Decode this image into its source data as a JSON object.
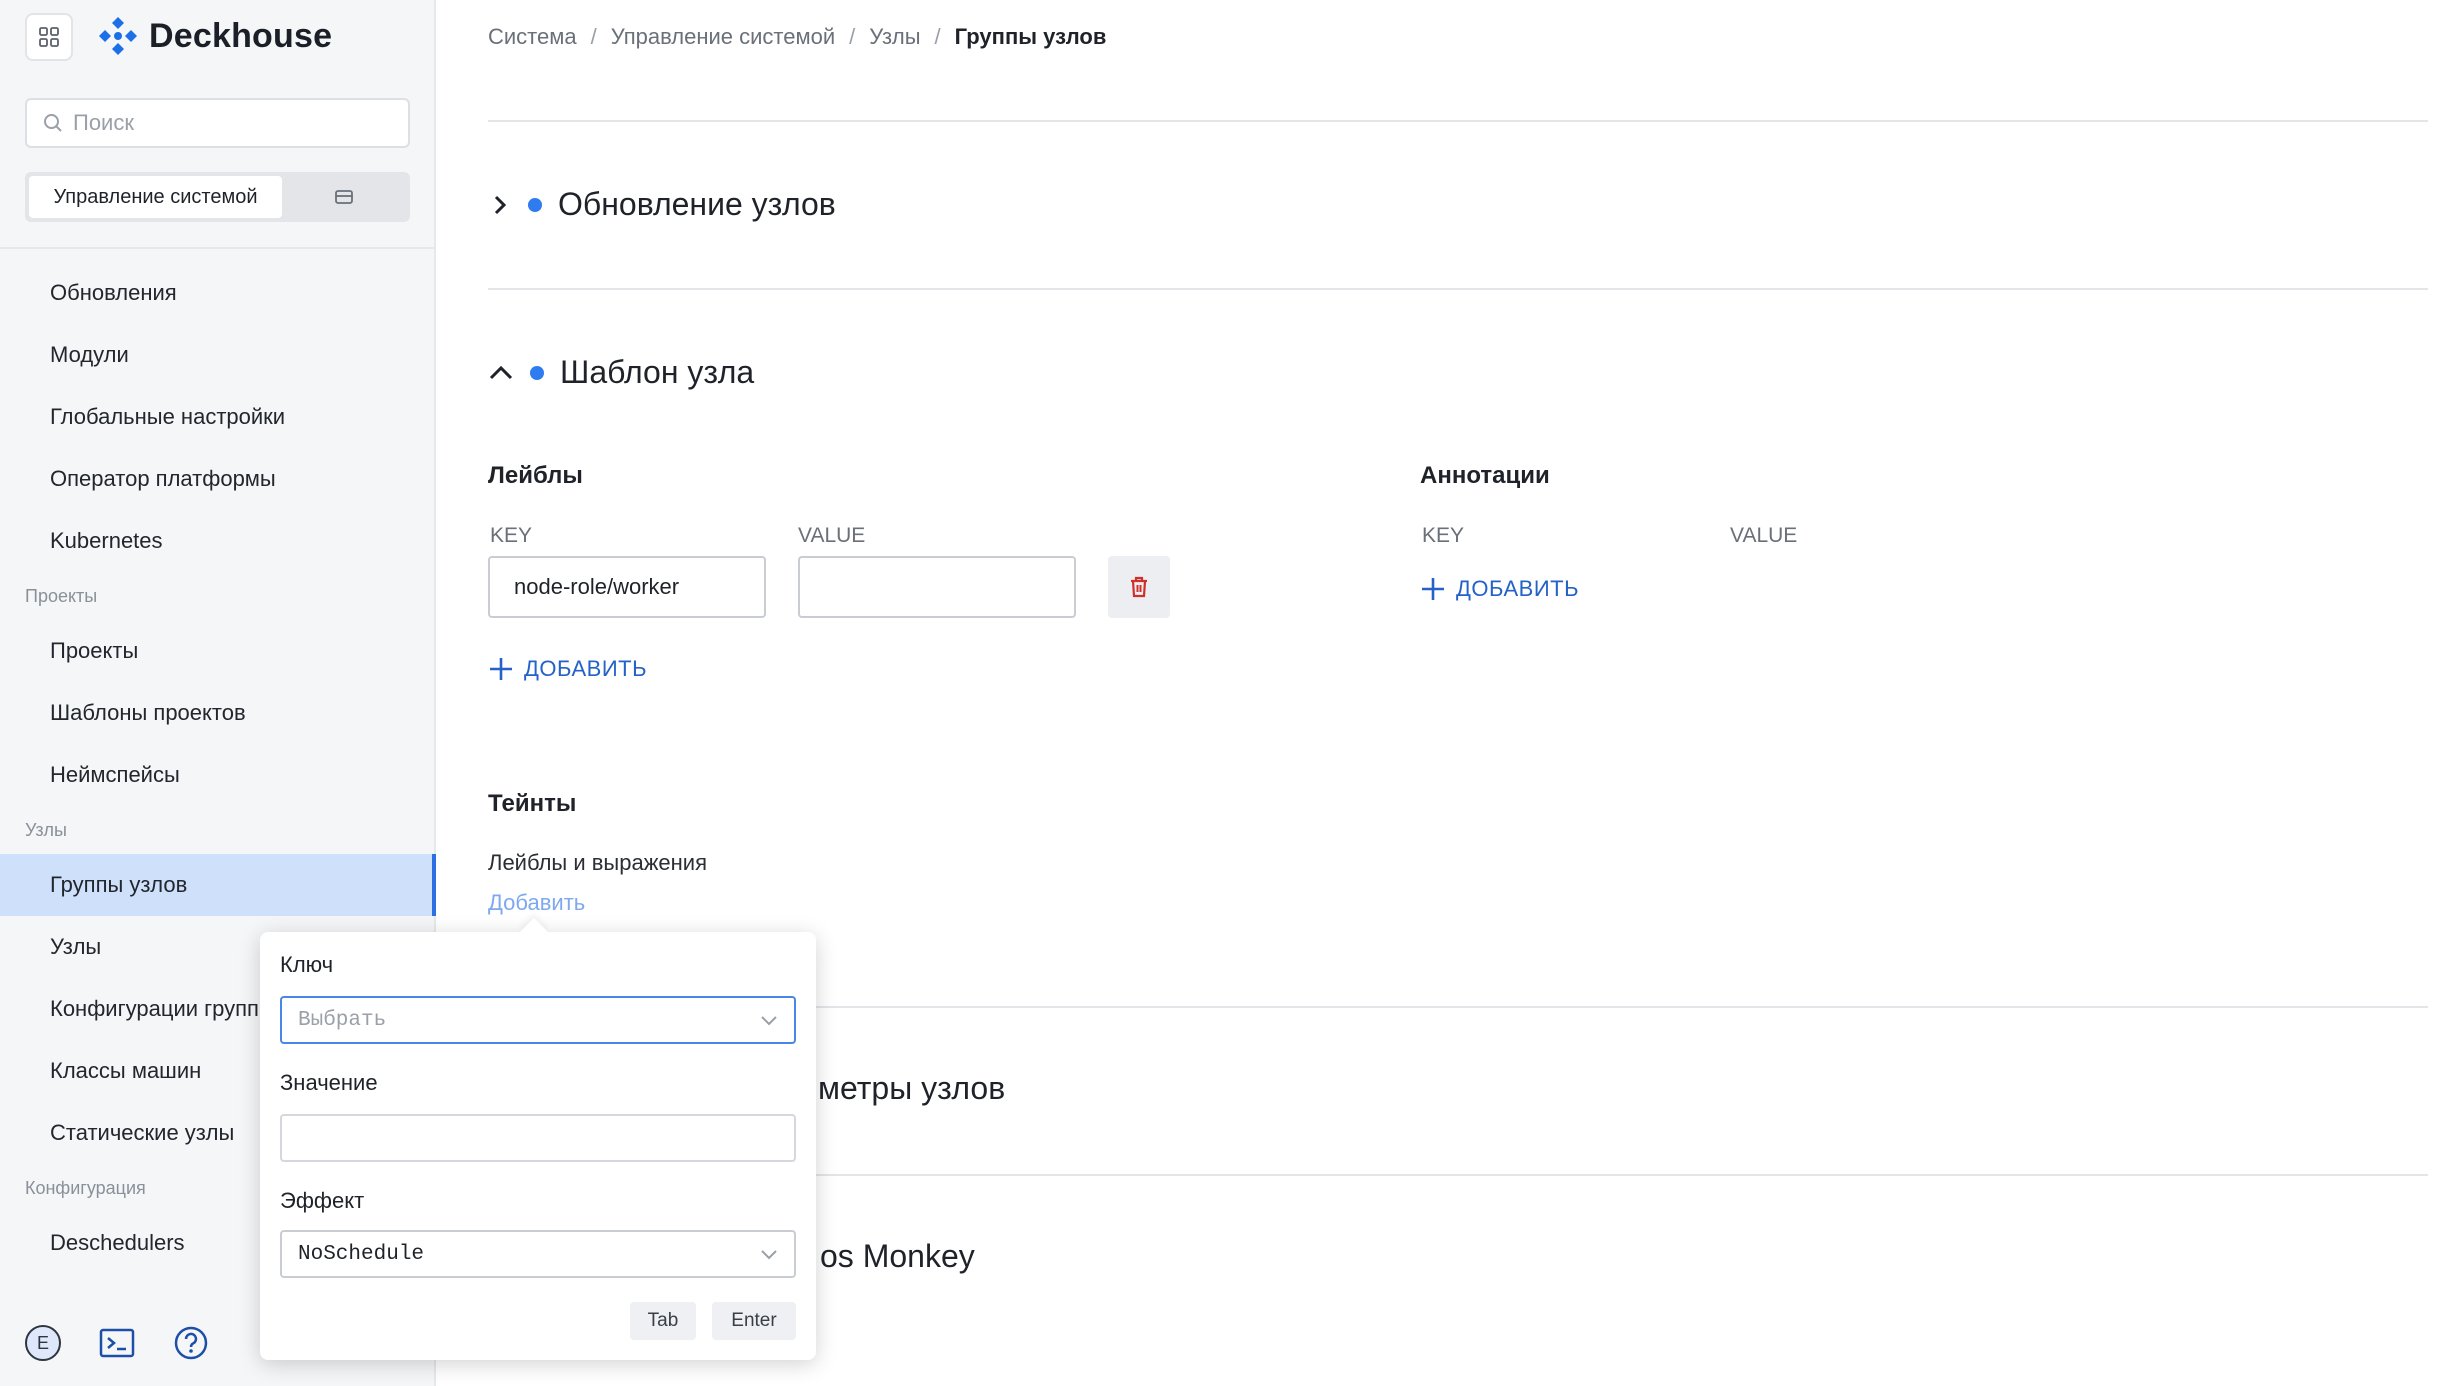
{
  "app": {
    "name": "Deckhouse"
  },
  "sidebar": {
    "search_placeholder": "Поиск",
    "segment_active": "Управление системой",
    "items": [
      {
        "type": "item",
        "label": "Обновления"
      },
      {
        "type": "item",
        "label": "Модули"
      },
      {
        "type": "item",
        "label": "Глобальные настройки"
      },
      {
        "type": "item",
        "label": "Оператор платформы"
      },
      {
        "type": "item",
        "label": "Kubernetes"
      },
      {
        "type": "group",
        "label": "Проекты"
      },
      {
        "type": "item",
        "label": "Проекты"
      },
      {
        "type": "item",
        "label": "Шаблоны проектов"
      },
      {
        "type": "item",
        "label": "Неймспейсы"
      },
      {
        "type": "group",
        "label": "Узлы"
      },
      {
        "type": "item",
        "label": "Группы узлов",
        "active": true
      },
      {
        "type": "item",
        "label": "Узлы"
      },
      {
        "type": "item",
        "label": "Конфигурации групп узлов"
      },
      {
        "type": "item",
        "label": "Классы машин"
      },
      {
        "type": "item",
        "label": "Статические узлы"
      },
      {
        "type": "group",
        "label": "Конфигурация"
      },
      {
        "type": "item",
        "label": "Deschedulers"
      }
    ],
    "user_initial": "E"
  },
  "breadcrumbs": [
    "Система",
    "Управление системой",
    "Узлы",
    "Группы узлов"
  ],
  "breadcrumb_separator": "/",
  "sections": {
    "node_update": "Обновление узлов",
    "node_template": "Шаблон узла",
    "node_params_partial": "метры узлов",
    "chaos_partial": "os Monkey"
  },
  "labels_block": {
    "title": "Лейблы",
    "key_header": "KEY",
    "value_header": "VALUE",
    "rows": [
      {
        "key": "node-role/worker",
        "value": ""
      }
    ],
    "add_label": "ДОБАВИТЬ"
  },
  "annotations_block": {
    "title": "Аннотации",
    "key_header": "KEY",
    "value_header": "VALUE",
    "add_label": "ДОБАВИТЬ"
  },
  "taints_block": {
    "title": "Тейнты",
    "subtitle": "Лейблы и выражения",
    "add_link": "Добавить"
  },
  "popover": {
    "key_label": "Ключ",
    "key_placeholder": "Выбрать",
    "value_label": "Значение",
    "effect_label": "Эффект",
    "effect_value": "NoSchedule",
    "tab_label": "Tab",
    "enter_label": "Enter"
  },
  "colors": {
    "accent": "#2f7cf0",
    "link": "#2462c8",
    "active_nav": "#cfe0fb",
    "danger": "#d0302c"
  }
}
